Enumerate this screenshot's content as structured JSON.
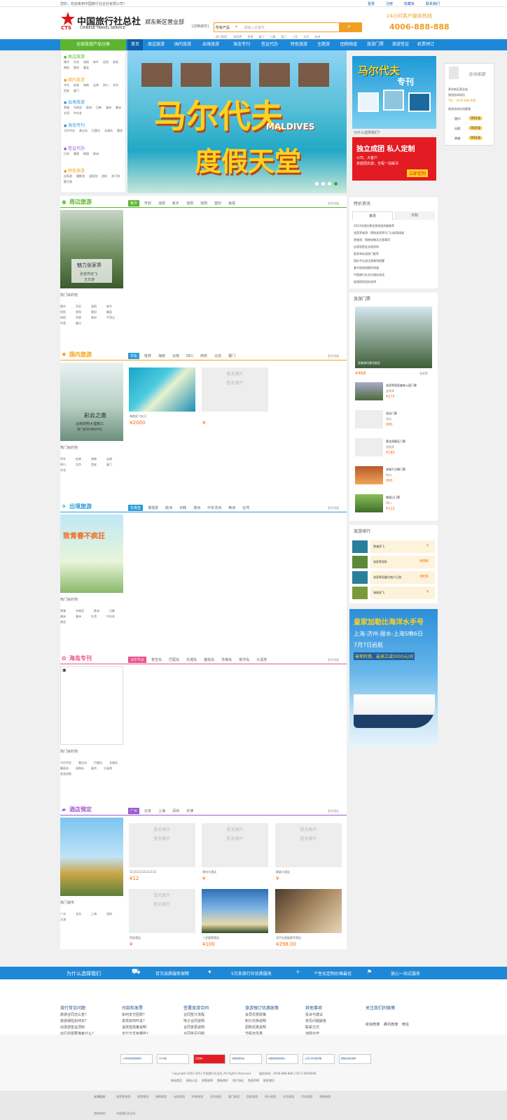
{
  "topbar": {
    "welcome": "您好，欢迎来到中国旅行社总社有限公司！",
    "links": [
      "登录",
      "注册",
      "收藏夹",
      "联系我们"
    ]
  },
  "header": {
    "logo_cn": "中国旅行社总社",
    "logo_en": "CHINESE TRAVEL SERVICE",
    "logo_abbr": "CTS",
    "branch": "郑东新区营业部",
    "switch": "[切换城市]",
    "search_category": "所有产品",
    "search_placeholder": "请输入关键字",
    "hot_words": [
      "热门搜索:",
      "张家界",
      "香港",
      "澳门",
      "九寨",
      "厦门",
      "三亚",
      "北京",
      "桂林"
    ],
    "hotline_label": "24小时客户服务热线",
    "hotline": "4006-888-888"
  },
  "nav": {
    "category": "全部旅游产品分类",
    "items": [
      "首页",
      "周边旅游",
      "国内旅游",
      "出境旅游",
      "海岛专刊",
      "签证代办",
      "特色旅游",
      "主题游",
      "团购频道",
      "旅游门票",
      "旅游签证",
      "机票预订"
    ]
  },
  "category_menu": [
    {
      "title": "周边旅游",
      "items": [
        "焦作",
        "开封",
        "洛阳",
        "新乡",
        "信阳",
        "安阳",
        "南阳",
        "登封",
        "嵩县"
      ]
    },
    {
      "title": "国内旅游",
      "items": [
        "华东",
        "桂林",
        "海南",
        "云南",
        "四川",
        "北京",
        "西安",
        "厦门",
        "东北"
      ]
    },
    {
      "title": "出境旅游",
      "items": [
        "港澳",
        "东南亚",
        "欧洲",
        "日韩",
        "澳洲",
        "美洲",
        "台湾",
        "中东非",
        "南亚"
      ]
    },
    {
      "title": "海岛专刊",
      "items": [
        "马尔代夫",
        "普吉岛",
        "巴厘岛",
        "长滩岛",
        "塞班",
        "毛里求斯"
      ]
    },
    {
      "title": "签证代办",
      "items": [
        "日本",
        "美国",
        "韩国",
        "欧洲",
        "澳洲"
      ]
    },
    {
      "title": "特色旅游",
      "items": [
        "自驾游",
        "摄影游",
        "温泉游",
        "游轮",
        "亲子游",
        "蜜月游"
      ]
    }
  ],
  "banner": {
    "title": "马尔代夫",
    "en": "MALDIVES",
    "subtitle": "度假天堂"
  },
  "side_ads": {
    "maldives_title": "马尔代夫",
    "maldives_sub": "专刊",
    "why": "为什么选择我们？",
    "custom_title": "独立成团 私人定制",
    "custom_sub1": "公司、大客户",
    "custom_sub2": "家庭团出游，全程一站解决",
    "custom_btn": "立即定制"
  },
  "service": {
    "online": "在线客服",
    "dept1": "郑东新区营业部",
    "dept2": "旅游咨询电话",
    "phone": "TEL：4006-888-888",
    "dept3": "旅游咨询在线客服",
    "qqs": [
      {
        "label": "国内：",
        "btn": "QQ交谈"
      },
      {
        "label": "出境：",
        "btn": "QQ交谈"
      },
      {
        "label": "港澳：",
        "btn": "QQ交谈"
      }
    ]
  },
  "sections": [
    {
      "id": "zhoubian",
      "title": "周边旅游",
      "color": "#5cb531",
      "tabs": [
        "焦作",
        "开封",
        "洛阳",
        "新乡",
        "信阳",
        "安阳",
        "登封",
        "嵩县"
      ],
      "more": "更多线路",
      "img_caption": "魅力张家界",
      "img_sub": "张家界双飞",
      "img_price": "五日游",
      "hot_label": "热门目的地",
      "hot": [
        "焦作",
        "开封",
        "洛阳",
        "新乡",
        "信阳",
        "安阳",
        "登封",
        "嵩县",
        "南阳",
        "济源",
        "林州",
        "平顶山",
        "许昌",
        "嵩山"
      ]
    },
    {
      "id": "guonei",
      "title": "国内旅游",
      "color": "#f5a31a",
      "tabs": [
        "华东",
        "桂林",
        "海南",
        "云南",
        "四川",
        "西安",
        "北京",
        "厦门"
      ],
      "more": "更多线路",
      "img_caption": "彩云之南",
      "img_sub": "云南昆明大理丽江",
      "img_price": "双飞6天4800元",
      "hot_label": "热门目的地",
      "hot": [
        "华东",
        "桂林",
        "海南",
        "云南",
        "四川",
        "北京",
        "西安",
        "厦门",
        "东北"
      ],
      "products": [
        {
          "name": "海南双飞五日",
          "price": "¥2000"
        },
        {
          "name": "",
          "price": "¥"
        }
      ]
    },
    {
      "id": "chujing",
      "title": "出境旅游",
      "color": "#2b9bd6",
      "tabs": [
        "东南亚",
        "港澳游",
        "欧洲",
        "日韩",
        "澳洲",
        "中东非洲",
        "美洲",
        "台湾",
        "南亚"
      ],
      "more": "更多线路",
      "img_caption": "致青春不疯狂",
      "hot_label": "热门目的地",
      "hot": [
        "港澳",
        "东南亚",
        "欧洲",
        "日韩",
        "澳洲",
        "美洲",
        "台湾",
        "中东非",
        "南亚"
      ]
    },
    {
      "id": "haidao",
      "title": "海岛专刊",
      "color": "#e8508a",
      "tabs": [
        "马尔代夫",
        "普吉岛",
        "巴厘岛",
        "长滩岛",
        "塞班岛",
        "苏梅岛",
        "斐济岛",
        "大溪地"
      ],
      "more": "更多线路",
      "hot_label": "热门目的地",
      "hot": [
        "马尔代夫",
        "普吉岛",
        "巴厘岛",
        "长滩岛",
        "塞班岛",
        "苏梅岛",
        "斐济",
        "大溪地",
        "毛里求斯"
      ]
    },
    {
      "id": "jiudian",
      "title": "酒店预定",
      "color": "#9b59d0",
      "tabs": [
        "广州",
        "北京",
        "上海",
        "深圳",
        "天津"
      ],
      "more": "更多酒店",
      "hot_label": "热门城市",
      "hot": [
        "广州",
        "北京",
        "上海",
        "深圳",
        "天津"
      ],
      "products": [
        {
          "name": "111111111111111",
          "price": "¥12"
        },
        {
          "name": "郑州大酒店",
          "price": "¥"
        },
        {
          "name": "星级大酒店",
          "price": "¥"
        },
        {
          "name": "西安酒店",
          "price": "¥"
        },
        {
          "name": "三亚度假酒店",
          "price": "¥100"
        },
        {
          "name": "北京五星级豪华酒店",
          "price": "¥298.00"
        }
      ]
    }
  ],
  "placeholder_text": "暂无图片",
  "news": {
    "title": "特价资讯",
    "tabs": [
      "资讯",
      "攻略"
    ],
    "items": [
      "2013年国庆黄金周旅游线路推荐",
      "张家界旅游：揭秘张家界天门山玻璃栈道",
      "港澳游：购物攻略及注意事项",
      "出境游签证办理须知",
      "夏季海岛游热门推荐",
      "国庆节出游注意事项提醒",
      "春节旅游线路早知道",
      "中国旅行社总社服务承诺",
      "旅游保险相关说明"
    ]
  },
  "tickets": {
    "title": "旅游门票",
    "featured_caption": "武陵源风景名胜区",
    "featured_price": "¥468",
    "featured_tag": "张家界",
    "list": [
      {
        "name": "张家界国家森林公园门票",
        "tag": "张家界",
        "price": "¥175"
      },
      {
        "name": "测试门票",
        "tag": "测试",
        "price": "¥80"
      },
      {
        "name": "黄龙洞景区门票",
        "tag": "张家界",
        "price": "¥180"
      },
      {
        "name": "宋城千古情门票",
        "tag": "杭州",
        "price": "¥60"
      },
      {
        "name": "峨眉山门票",
        "tag": "四川",
        "price": "¥122"
      }
    ]
  },
  "ranking": {
    "title": "旅游排行",
    "items": [
      {
        "name": "港澳双飞",
        "price": "¥"
      },
      {
        "name": "张家界双卧",
        "price": "¥888"
      },
      {
        "name": "张家界凤凰古城六日游",
        "price": "¥839"
      },
      {
        "name": "海南双飞",
        "price": "¥"
      }
    ]
  },
  "cruise_ad": {
    "title": "皇家加勒比海洋水手号",
    "route": "上海-济州-丽水-上海5晚6日",
    "date": "7月7日启航",
    "promo": "暑期特惠，最高立减3000元/间"
  },
  "promise": [
    "为什么选择我们",
    "百万品质服务保障",
    "5万条旅行社优质服务",
    "个性化定制价格最优",
    "放心一站式服务"
  ],
  "footer": {
    "cols": [
      {
        "title": "旅行常见问题",
        "items": [
          "旅游合同怎么签？",
          "旅游保险如何买？",
          "出境游签证须知",
          "出行前需要准备什么？"
        ]
      },
      {
        "title": "付款和发票",
        "items": [
          "如何支付团费？",
          "发票如何开具？",
          "退改签政策说明",
          "支付方式有哪些？"
        ]
      },
      {
        "title": "签署旅游合同",
        "items": [
          "合同签订流程",
          "电子合同说明",
          "合同变更说明",
          "合同常见问题"
        ]
      },
      {
        "title": "旅游預订优惠政策",
        "items": [
          "会员优惠政策",
          "积分兑换说明",
          "团购优惠说明",
          "节假日优惠"
        ]
      },
      {
        "title": "其他事项",
        "items": [
          "投诉与建议",
          "常见问题解答",
          "联系方式",
          "加盟合作"
        ]
      },
      {
        "title": "关注我们的微博",
        "items": [
          "新浪微博",
          "腾讯微博",
          "微信"
        ]
      }
    ],
    "badges": [
      "上海市旅游诚信单位",
      "沪ICP备",
      "百度推广",
      "中国旅游协会",
      "中国旅游诚信单位",
      "上海工商行政管理",
      "网络社会征信网"
    ],
    "copyright": "Copyright 2002-2013 中国旅行社总社 All Rights Reserved",
    "phone_line": "服务热线：4006-888-888 | 0371-6666666",
    "links": [
      "网站首页",
      "网站公告",
      "发票说明",
      "隐私保护",
      "用户协议",
      "免责声明",
      "联系我们"
    ],
    "friend_label": "友情链接：",
    "friend_links": [
      "张家界旅游",
      "香港旅游",
      "海南旅游",
      "云南旅游",
      "桂林旅游",
      "北京旅游",
      "厦门旅游",
      "西安旅游",
      "四川旅游",
      "东北旅游",
      "华东旅游",
      "港澳旅游"
    ],
    "partner_label": "合作伙伴：",
    "partner": "中国旅行社总社"
  }
}
